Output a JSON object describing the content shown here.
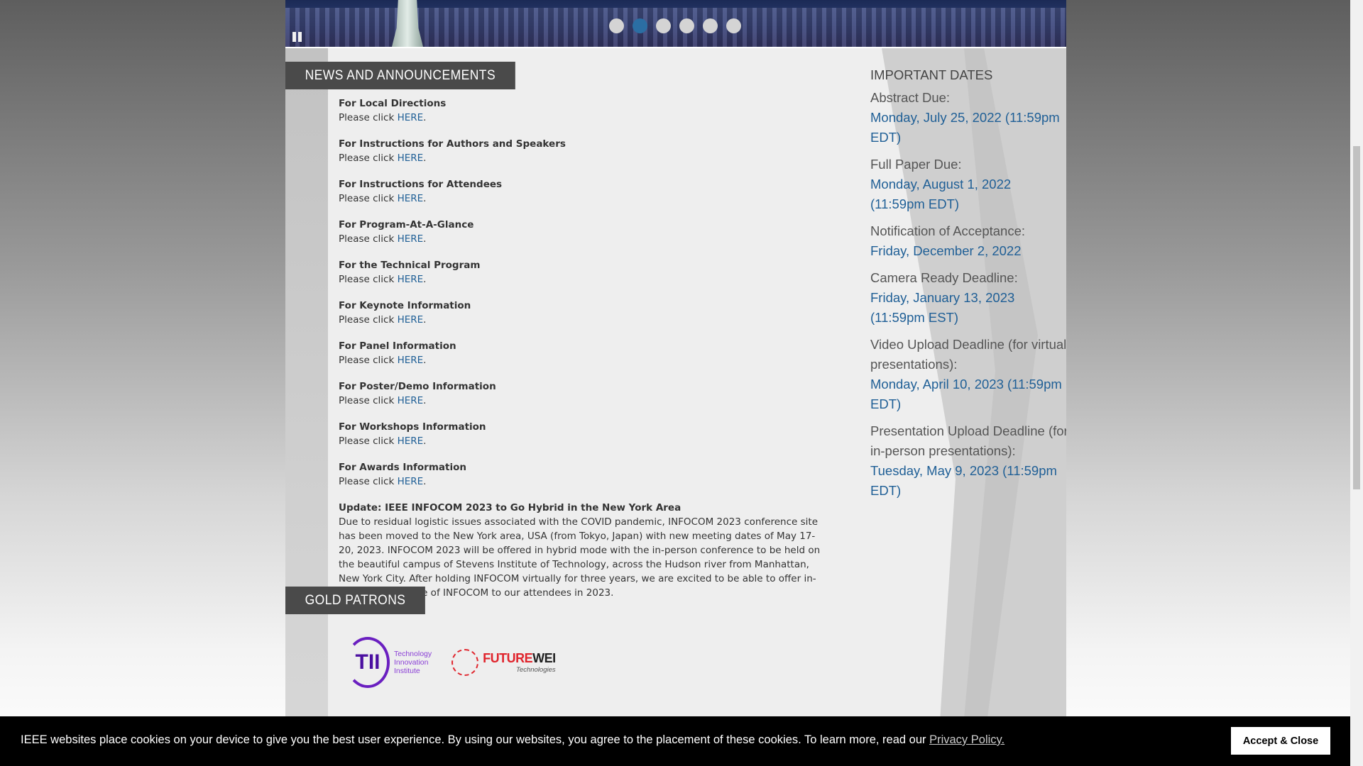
{
  "banner": {
    "slide_count": 6,
    "active_slide": 1
  },
  "news": {
    "header": "News and Announcements",
    "items": [
      {
        "title": "For Local Directions",
        "prefix": "Please click ",
        "link": "HERE",
        "suffix": "."
      },
      {
        "title": "For Instructions for Authors and Speakers",
        "prefix": "Please click ",
        "link": "HERE",
        "suffix": "."
      },
      {
        "title": "For Instructions for Attendees",
        "prefix": "Please click ",
        "link": "HERE",
        "suffix": "."
      },
      {
        "title": "For Program-At-A-Glance",
        "prefix": "Please click ",
        "link": "HERE",
        "suffix": "."
      },
      {
        "title": "For the Technical Program",
        "prefix": "Please click ",
        "link": "HERE",
        "suffix": "."
      },
      {
        "title": "For Keynote Information",
        "prefix": "Please click ",
        "link": "HERE",
        "suffix": "."
      },
      {
        "title": "For Panel Information",
        "prefix": "Please click ",
        "link": "HERE",
        "suffix": "."
      },
      {
        "title": "For Poster/Demo Information",
        "prefix": "Please click ",
        "link": "HERE",
        "suffix": "."
      },
      {
        "title": "For Workshops Information",
        "prefix": "Please click ",
        "link": "HERE",
        "suffix": "."
      },
      {
        "title": "For Awards Information",
        "prefix": "Please click ",
        "link": "HERE",
        "suffix": "."
      }
    ],
    "update_title": "Update: IEEE INFOCOM 2023 to Go Hybrid in the New York Area",
    "update_body": "Due to residual logistic issues associated with the COVID pandemic, INFOCOM 2023 conference site has been moved to the New York area, USA (from Tokyo, Japan) with new meeting dates of May 17-20, 2023. INFOCOM 2023 will be offered in hybrid mode with the in-person conference to be held on the beautiful campus of Stevens Institute of Technology, across the Hudson river from Manhattan, New York City. After holding INFOCOM virtually for three years, we are excited to be able to offer in-person experience of INFOCOM to our attendees in 2023."
  },
  "dates": {
    "heading": "IMPORTANT DATES",
    "items": [
      {
        "label": "Abstract Due:",
        "value": "Monday, July 25, 2022 (11:59pm EDT)"
      },
      {
        "label": "Full Paper Due:",
        "value": "Monday, August 1, 2022 (11:59pm EDT)"
      },
      {
        "label": "Notification of Acceptance:",
        "value": "Friday, December 2, 2022"
      },
      {
        "label": "Camera Ready Deadline:",
        "value": "Friday, January 13, 2023 (11:59pm EST)"
      },
      {
        "label": "Video Upload Deadline (for virtual presentations):",
        "value": "Monday, April 10, 2023 (11:59pm EDT)"
      },
      {
        "label": "Presentation Upload Deadline (for in-person presentations):",
        "value": "Tuesday, May 9, 2023 (11:59pm EDT)"
      }
    ]
  },
  "patrons": {
    "header": "Gold Patrons",
    "tii": {
      "mark": "TII",
      "line1": "Technology",
      "line2": "Innovation",
      "line3": "Institute"
    },
    "futurewei": {
      "name_red": "FUTURE",
      "name_dark": "WEI",
      "sub": "Technologies"
    }
  },
  "cookie": {
    "text": "IEEE websites place cookies on your device to give you the best user experience. By using our websites, you agree to the placement of these cookies. To learn more, read our ",
    "link": "Privacy Policy.",
    "button": "Accept & Close"
  },
  "colors": {
    "link_blue": "#1f5f96",
    "header_gray": "#4a4a4a",
    "active_dot": "#2b6ea3"
  }
}
